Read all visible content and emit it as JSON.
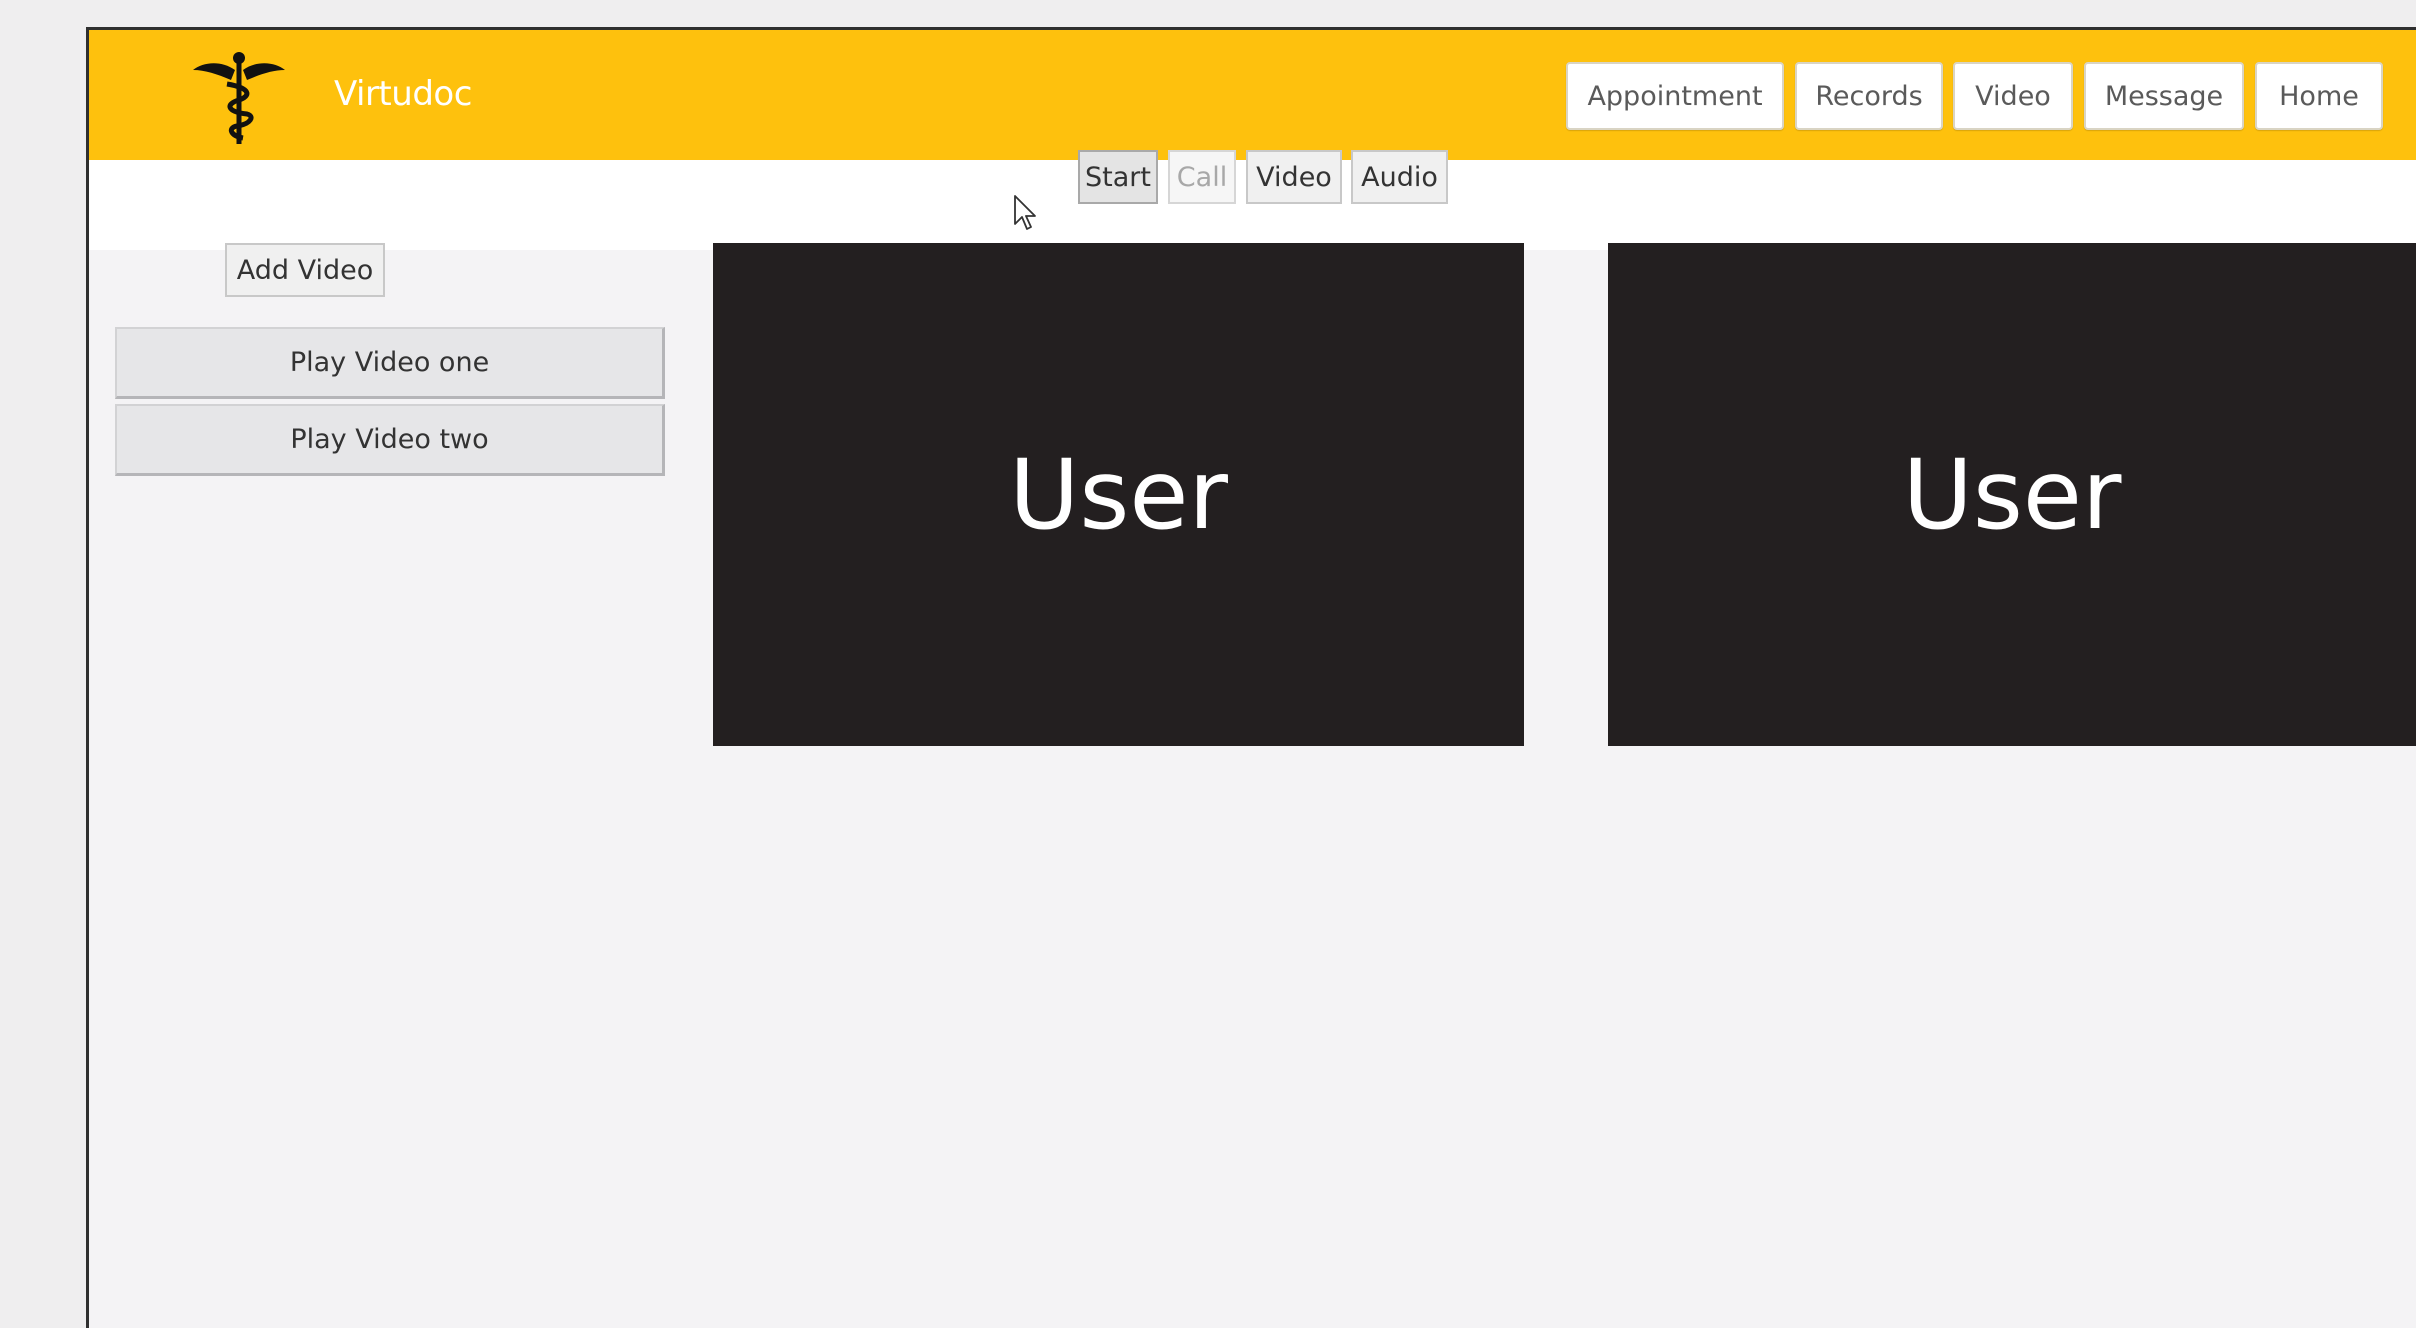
{
  "header": {
    "title": "Virtudoc",
    "logo_icon": "caduceus-icon",
    "nav": [
      {
        "label": "Appointment"
      },
      {
        "label": "Records"
      },
      {
        "label": "Video"
      },
      {
        "label": "Message"
      },
      {
        "label": "Home"
      }
    ]
  },
  "controls": {
    "start": "Start",
    "call": "Call",
    "video": "Video",
    "audio": "Audio"
  },
  "sidebar": {
    "add_video": "Add Video",
    "items": [
      {
        "label": "Play Video one"
      },
      {
        "label": "Play Video two"
      }
    ]
  },
  "videos": [
    {
      "label": "User"
    },
    {
      "label": "User"
    }
  ],
  "colors": {
    "header": "#fec10d",
    "video_bg": "#231f20"
  }
}
